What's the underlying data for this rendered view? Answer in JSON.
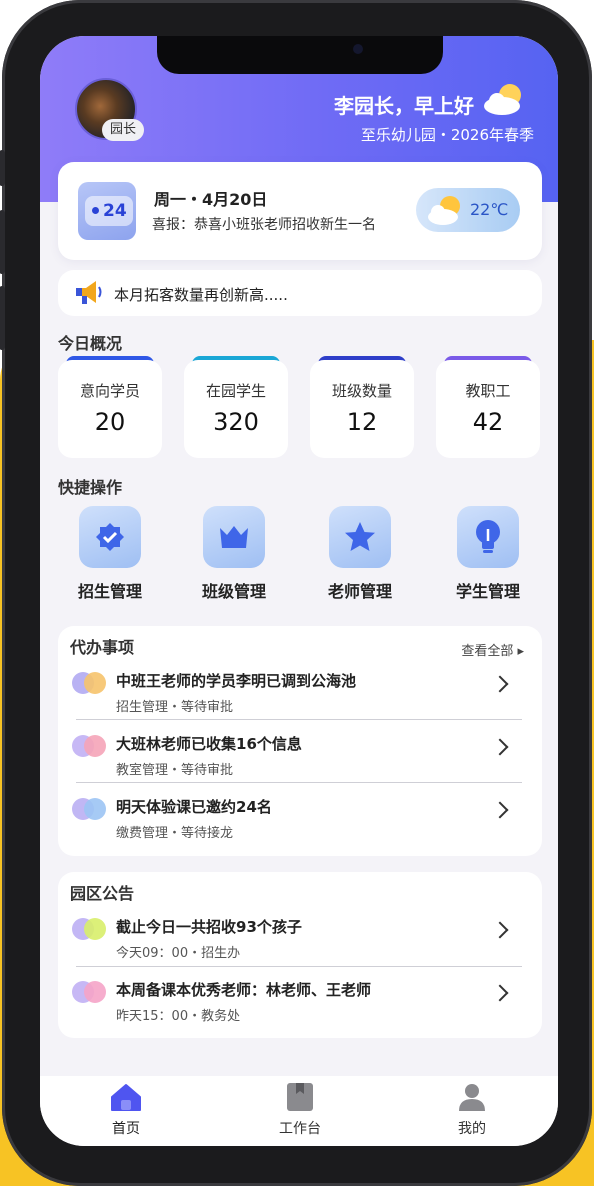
{
  "header": {
    "greeting": "李园长，早上好",
    "role_badge": "园长",
    "school_line": "至乐幼儿园・2026年春季"
  },
  "date_card": {
    "calendar_number": "24",
    "date": "周一・4月20日",
    "news": "喜报：恭喜小班张老师招收新生一名",
    "temperature": "22℃"
  },
  "notice": {
    "text": "本月拓客数量再创新高....."
  },
  "overview": {
    "title": "今日概况",
    "stats": [
      {
        "label": "意向学员",
        "value": "20",
        "color": "#2F57E6"
      },
      {
        "label": "在园学生",
        "value": "320",
        "color": "#1AA7D6"
      },
      {
        "label": "班级数量",
        "value": "12",
        "color": "#2E3EC9"
      },
      {
        "label": "教职工",
        "value": "42",
        "color": "#7A5AE8"
      }
    ]
  },
  "quick_actions": {
    "title": "快捷操作",
    "items": [
      {
        "label": "招生管理",
        "icon": "badge-check-icon"
      },
      {
        "label": "班级管理",
        "icon": "crown-icon"
      },
      {
        "label": "老师管理",
        "icon": "star-icon"
      },
      {
        "label": "学生管理",
        "icon": "lightbulb-icon"
      }
    ]
  },
  "todos": {
    "title": "代办事项",
    "view_all": "查看全部 ▸",
    "items": [
      {
        "title": "中班王老师的学员李明已调到公海池",
        "sub": "招生管理・等待审批",
        "c1": "#B9B2F3",
        "c2": "#F6C36B"
      },
      {
        "title": "大班林老师已收集16个信息",
        "sub": "教室管理・等待审批",
        "c1": "#C7B8F5",
        "c2": "#F5A4B8"
      },
      {
        "title": "明天体验课已邀约24名",
        "sub": "缴费管理・等待接龙",
        "c1": "#C1B7F4",
        "c2": "#9CC4F4"
      }
    ]
  },
  "announcements": {
    "title": "园区公告",
    "items": [
      {
        "title": "截止今日一共招收93个孩子",
        "sub": "今天09：00・招生办",
        "c1": "#C3B7F5",
        "c2": "#D8EE6A"
      },
      {
        "title": "本周备课本优秀老师：林老师、王老师",
        "sub": "昨天15：00・教务处",
        "c1": "#C7B8F5",
        "c2": "#F5A4C8"
      }
    ]
  },
  "tabbar": {
    "tabs": [
      {
        "label": "首页",
        "active": true
      },
      {
        "label": "工作台",
        "active": false
      },
      {
        "label": "我的",
        "active": false
      }
    ]
  },
  "colors": {
    "accent": "#4F55F0",
    "hero_start": "#8F7CF8",
    "hero_end": "#5663F2",
    "yellow": "#F7C324"
  }
}
